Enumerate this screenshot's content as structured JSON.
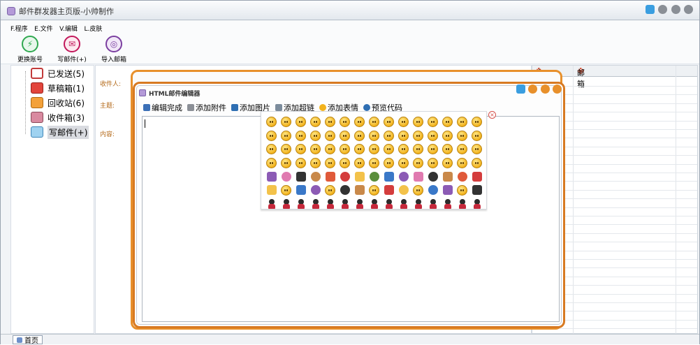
{
  "window": {
    "title": "邮件群发器主页版-小帅制作"
  },
  "menu": {
    "items": [
      {
        "label": "F.程序"
      },
      {
        "label": "E.文件"
      },
      {
        "label": "V.编辑"
      },
      {
        "label": "L.皮肤"
      }
    ]
  },
  "toolbar": {
    "buttons": [
      {
        "label": "更换账号",
        "icon": "switch-account-icon",
        "color": "#2fa84f"
      },
      {
        "label": "写邮件(+)",
        "icon": "compose-mail-icon",
        "color": "#c2185b"
      },
      {
        "label": "导入邮箱",
        "icon": "import-mailbox-icon",
        "color": "#7b3fa0"
      }
    ]
  },
  "tree": {
    "items": [
      {
        "label": "已发送(5)",
        "icon": "sent-box-icon"
      },
      {
        "label": "草稿箱(1)",
        "icon": "drafts-box-icon"
      },
      {
        "label": "回收站(6)",
        "icon": "recycle-bin-icon"
      },
      {
        "label": "收件箱(3)",
        "icon": "inbox-icon"
      },
      {
        "label": "写邮件(+)",
        "icon": "compose-icon"
      }
    ]
  },
  "form": {
    "recipient_label": "收件人:",
    "subject_label": "主题:",
    "content_label": "内容:"
  },
  "grid": {
    "columns": [
      {
        "label": "序号"
      },
      {
        "label": "邮箱"
      }
    ]
  },
  "editor_dialog": {
    "title": "HTML邮件编辑器",
    "toolbar": [
      {
        "label": "编辑完成",
        "icon": "done-icon"
      },
      {
        "label": "添加附件",
        "icon": "attachment-icon"
      },
      {
        "label": "添加图片",
        "icon": "image-icon"
      },
      {
        "label": "添加超链",
        "icon": "link-icon"
      },
      {
        "label": "添加表情",
        "icon": "emoticon-icon"
      },
      {
        "label": "预览代码",
        "icon": "preview-code-icon"
      }
    ],
    "content": ""
  },
  "statusbar": {
    "tab_label": "首页"
  },
  "colors": {
    "accent_orange": "#e8902b",
    "title_icon": "#b49ad8",
    "label_brown": "#b46a1a",
    "grid_marker": "#d23a1a"
  }
}
